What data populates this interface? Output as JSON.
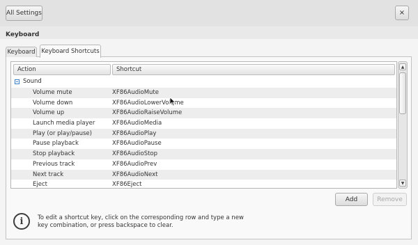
{
  "header": {
    "all_settings_label": "All Settings",
    "close_label": "×",
    "section_title": "Keyboard"
  },
  "tabs": [
    {
      "label": "Keyboard",
      "active": false
    },
    {
      "label": "Keyboard Shortcuts",
      "active": true
    }
  ],
  "table": {
    "columns": [
      "Action",
      "Shortcut"
    ],
    "group": {
      "label": "Sound",
      "expanded": true
    },
    "rows": [
      {
        "action": "Volume mute",
        "shortcut": "XF86AudioMute"
      },
      {
        "action": "Volume down",
        "shortcut": "XF86AudioLowerVolume"
      },
      {
        "action": "Volume up",
        "shortcut": "XF86AudioRaiseVolume"
      },
      {
        "action": "Launch media player",
        "shortcut": "XF86AudioMedia"
      },
      {
        "action": "Play (or play/pause)",
        "shortcut": "XF86AudioPlay"
      },
      {
        "action": "Pause playback",
        "shortcut": "XF86AudioPause"
      },
      {
        "action": "Stop playback",
        "shortcut": "XF86AudioStop"
      },
      {
        "action": "Previous track",
        "shortcut": "XF86AudioPrev"
      },
      {
        "action": "Next track",
        "shortcut": "XF86AudioNext"
      },
      {
        "action": "Eject",
        "shortcut": "XF86Eject"
      }
    ]
  },
  "buttons": {
    "add_label": "Add",
    "remove_label": "Remove"
  },
  "info": {
    "icon": "info-icon",
    "text": "To edit a shortcut key, click on the corresponding row and type a new key combination, or press backspace to clear."
  },
  "colors": {
    "expander_accent": "#3a7fc8"
  }
}
